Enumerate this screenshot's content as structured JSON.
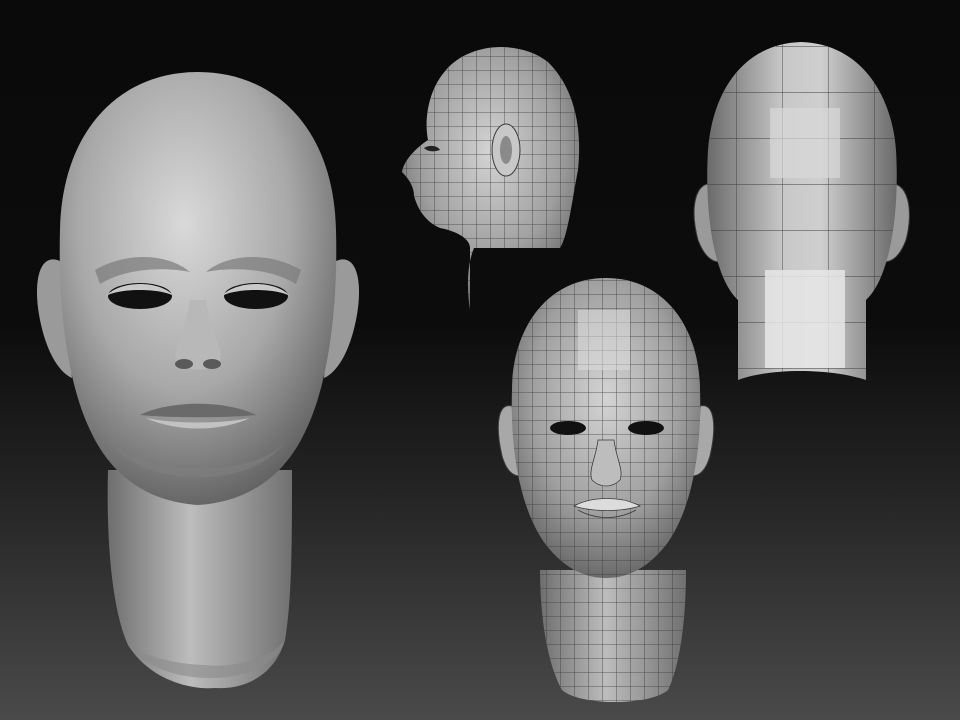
{
  "scene": {
    "background_top": "#0a0a0a",
    "background_bottom": "#4a4a4a",
    "models": [
      {
        "id": "sculpt-front",
        "view": "front",
        "style": "smooth-sculpt"
      },
      {
        "id": "wire-side",
        "view": "side",
        "style": "wireframe"
      },
      {
        "id": "wire-back",
        "view": "back",
        "style": "wireframe"
      },
      {
        "id": "wire-front",
        "view": "front",
        "style": "wireframe"
      }
    ]
  }
}
